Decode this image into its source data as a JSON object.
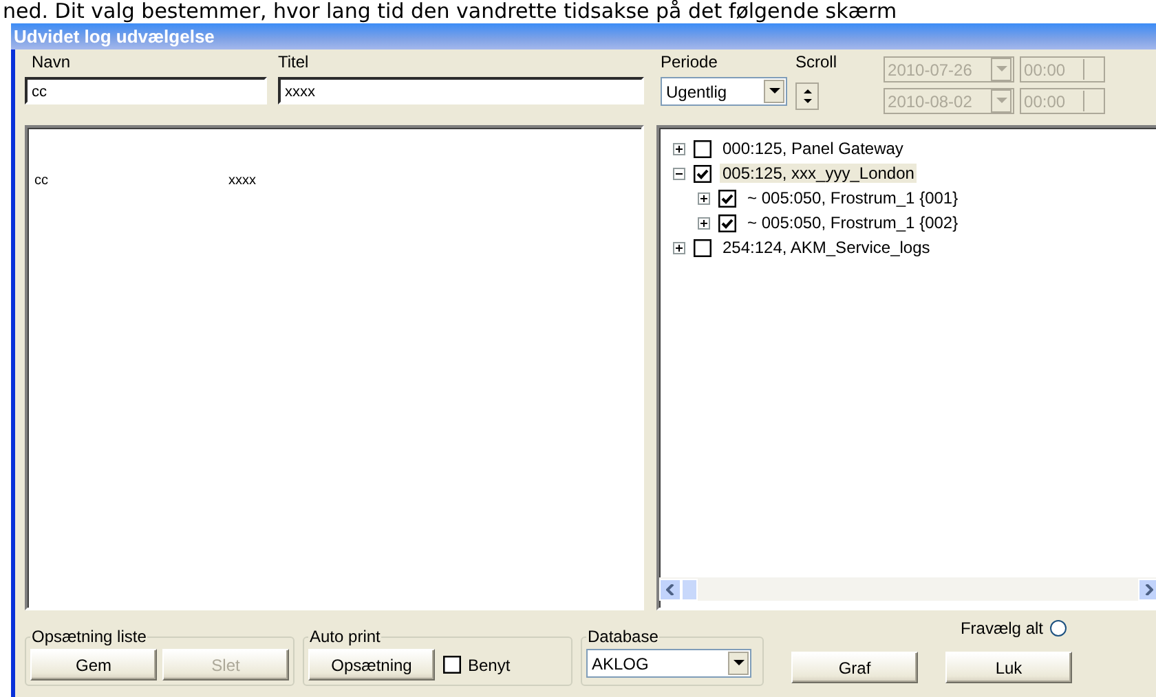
{
  "background_text": "ned. Dit valg bestemmer, hvor lang tid den vandrette tidsakse på det følgende skærm",
  "window": {
    "title": "Udvidet log udvælgelse"
  },
  "fields": {
    "name": {
      "label": "Navn",
      "value": "cc"
    },
    "title": {
      "label": "Titel",
      "value": "xxxx"
    },
    "period": {
      "label": "Periode",
      "value": "Ugentlig"
    },
    "scroll": {
      "label": "Scroll"
    },
    "from_date": {
      "value": "2010-07-26",
      "disabled": true
    },
    "from_time": {
      "value": "00:00",
      "disabled": true
    },
    "to_date": {
      "value": "2010-08-02",
      "disabled": true
    },
    "to_time": {
      "value": "00:00",
      "disabled": true
    }
  },
  "list_rows": [
    {
      "cells": [
        "cc",
        "xxxx"
      ]
    }
  ],
  "tree": [
    {
      "label": "000:125, Panel Gateway",
      "checked": false,
      "expanded": false,
      "selected": false
    },
    {
      "label": "005:125, xxx_yyy_London",
      "checked": true,
      "expanded": true,
      "selected": true,
      "children": [
        {
          "label": "~ 005:050, Frostrum_1  {001}",
          "checked": true,
          "expanded": false,
          "selected": false
        },
        {
          "label": "~ 005:050, Frostrum_1  {002}",
          "checked": true,
          "expanded": false,
          "selected": false
        }
      ]
    },
    {
      "label": "254:124, AKM_Service_logs",
      "checked": false,
      "expanded": false,
      "selected": false
    }
  ],
  "setup_list": {
    "title": "Opsætning liste",
    "buttons": [
      {
        "label": "Gem",
        "disabled": false
      },
      {
        "label": "Slet",
        "disabled": true
      }
    ]
  },
  "auto_print": {
    "title": "Auto print",
    "button": {
      "label": "Opsætning"
    },
    "use": {
      "label": "Benyt",
      "checked": false
    }
  },
  "database": {
    "title": "Database",
    "value": "AKLOG"
  },
  "deselect_all": {
    "label": "Fravælg alt",
    "selected": false
  },
  "buttons": [
    {
      "label": "Graf",
      "disabled": false
    },
    {
      "label": "Luk",
      "disabled": false
    }
  ]
}
